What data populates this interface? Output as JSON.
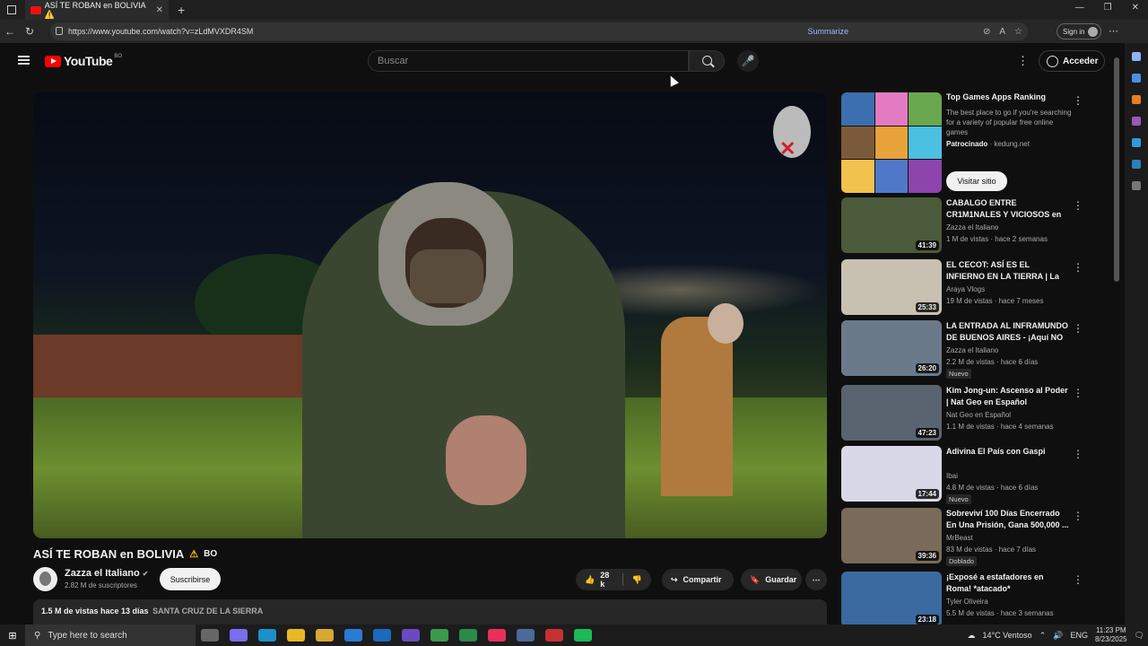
{
  "browser": {
    "tab_title": "ASÍ TE ROBAN en BOLIVIA ⚠️",
    "url": "https://www.youtube.com/watch?v=zLdMVXDR4SM",
    "summarize_label": "Summarize",
    "signin_label": "Sign in"
  },
  "yt": {
    "logo_text": "YouTube",
    "country_code": "BO",
    "search_placeholder": "Buscar",
    "signin_label": "Acceder"
  },
  "video": {
    "title": "ASÍ TE ROBAN en BOLIVIA",
    "title_tag": "BO",
    "channel": "Zazza el Italiano",
    "subscribers": "2.82 M de suscriptores",
    "subscribe_label": "Suscribirse",
    "likes": "28 k",
    "share_label": "Compartir",
    "save_label": "Guardar",
    "views_date": "1.5 M de vistas  hace 13 días",
    "location": "SANTA CRUZ DE LA SIERRA"
  },
  "ad": {
    "title": "Top Games Apps Ranking",
    "description": "The best place to go if you're searching for a variety of popular free online games",
    "sponsored": "Patrocinado",
    "domain": "· kedung.net",
    "visit_label": "Visitar sitio",
    "tile_colors": [
      "#3b6fb0",
      "#e27bc2",
      "#6aa84f",
      "#7b5a3c",
      "#e8a23a",
      "#4cc0e0",
      "#f2c14e",
      "#5078c8",
      "#8e44ad"
    ]
  },
  "sidebar": [
    {
      "title": "CABALGO ENTRE CR1M1NALES Y VICIOSOS en ...",
      "channel": "Zazza el Italiano",
      "meta": "1 M de vistas · hace 2 semanas",
      "duration": "41:39",
      "badge": "",
      "color": "#4a5a3a"
    },
    {
      "title": "EL CECOT: ASÍ ES EL INFIERNO EN LA TIERRA | La REALIDAD ...",
      "channel": "Araya Vlogs",
      "meta": "19 M de vistas · hace 7 meses",
      "duration": "25:33",
      "badge": "",
      "color": "#c8c0b0"
    },
    {
      "title": "LA ENTRADA AL INFRAMUNDO DE BUENOS AIRES - ¡Aquí NO ...",
      "channel": "Zazza el Italiano",
      "meta": "2.2 M de vistas · hace 6 días",
      "duration": "26:20",
      "badge": "Nuevo",
      "color": "#6a7a8a"
    },
    {
      "title": "Kim Jong-un: Ascenso al Poder | Nat Geo en Español",
      "channel": "Nat Geo en Español",
      "meta": "1.1 M de vistas · hace 4 semanas",
      "duration": "47:23",
      "badge": "",
      "color": "#5a6470"
    },
    {
      "title": "Adivina El País con Gaspi",
      "channel": "Ibai",
      "meta": "4.8 M de vistas · hace 6 días",
      "duration": "17:44",
      "badge": "Nuevo",
      "color": "#d8d8e8"
    },
    {
      "title": "Sobreviví 100 Días Encerrado En Una Prisión, Gana 500,000 ...",
      "channel": "MrBeast",
      "meta": "83 M de vistas · hace 7 días",
      "duration": "39:36",
      "badge": "Doblado",
      "color": "#7a6a5a"
    },
    {
      "title": "¡Exposé a estafadores en Roma! *atacado*",
      "channel": "Tyler Oliveira",
      "meta": "5.5 M de vistas · hace 3 semanas",
      "duration": "23:18",
      "badge": "",
      "color": "#3a6aa0"
    }
  ],
  "taskbar": {
    "search_placeholder": "Type here to search",
    "weather": "14°C  Ventoso",
    "lang": "ENG",
    "time": "11:23 PM",
    "date": "8/23/2025"
  }
}
